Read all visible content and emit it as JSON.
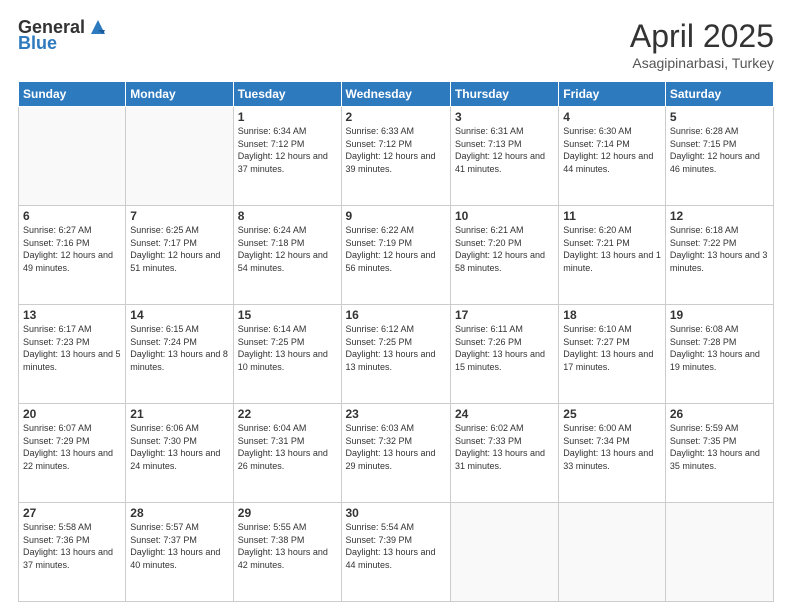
{
  "header": {
    "logo_general": "General",
    "logo_blue": "Blue",
    "title": "April 2025",
    "subtitle": "Asagipinarbasi, Turkey"
  },
  "calendar": {
    "days_of_week": [
      "Sunday",
      "Monday",
      "Tuesday",
      "Wednesday",
      "Thursday",
      "Friday",
      "Saturday"
    ],
    "weeks": [
      [
        {
          "day": "",
          "detail": ""
        },
        {
          "day": "",
          "detail": ""
        },
        {
          "day": "1",
          "detail": "Sunrise: 6:34 AM\nSunset: 7:12 PM\nDaylight: 12 hours and 37 minutes."
        },
        {
          "day": "2",
          "detail": "Sunrise: 6:33 AM\nSunset: 7:12 PM\nDaylight: 12 hours and 39 minutes."
        },
        {
          "day": "3",
          "detail": "Sunrise: 6:31 AM\nSunset: 7:13 PM\nDaylight: 12 hours and 41 minutes."
        },
        {
          "day": "4",
          "detail": "Sunrise: 6:30 AM\nSunset: 7:14 PM\nDaylight: 12 hours and 44 minutes."
        },
        {
          "day": "5",
          "detail": "Sunrise: 6:28 AM\nSunset: 7:15 PM\nDaylight: 12 hours and 46 minutes."
        }
      ],
      [
        {
          "day": "6",
          "detail": "Sunrise: 6:27 AM\nSunset: 7:16 PM\nDaylight: 12 hours and 49 minutes."
        },
        {
          "day": "7",
          "detail": "Sunrise: 6:25 AM\nSunset: 7:17 PM\nDaylight: 12 hours and 51 minutes."
        },
        {
          "day": "8",
          "detail": "Sunrise: 6:24 AM\nSunset: 7:18 PM\nDaylight: 12 hours and 54 minutes."
        },
        {
          "day": "9",
          "detail": "Sunrise: 6:22 AM\nSunset: 7:19 PM\nDaylight: 12 hours and 56 minutes."
        },
        {
          "day": "10",
          "detail": "Sunrise: 6:21 AM\nSunset: 7:20 PM\nDaylight: 12 hours and 58 minutes."
        },
        {
          "day": "11",
          "detail": "Sunrise: 6:20 AM\nSunset: 7:21 PM\nDaylight: 13 hours and 1 minute."
        },
        {
          "day": "12",
          "detail": "Sunrise: 6:18 AM\nSunset: 7:22 PM\nDaylight: 13 hours and 3 minutes."
        }
      ],
      [
        {
          "day": "13",
          "detail": "Sunrise: 6:17 AM\nSunset: 7:23 PM\nDaylight: 13 hours and 5 minutes."
        },
        {
          "day": "14",
          "detail": "Sunrise: 6:15 AM\nSunset: 7:24 PM\nDaylight: 13 hours and 8 minutes."
        },
        {
          "day": "15",
          "detail": "Sunrise: 6:14 AM\nSunset: 7:25 PM\nDaylight: 13 hours and 10 minutes."
        },
        {
          "day": "16",
          "detail": "Sunrise: 6:12 AM\nSunset: 7:25 PM\nDaylight: 13 hours and 13 minutes."
        },
        {
          "day": "17",
          "detail": "Sunrise: 6:11 AM\nSunset: 7:26 PM\nDaylight: 13 hours and 15 minutes."
        },
        {
          "day": "18",
          "detail": "Sunrise: 6:10 AM\nSunset: 7:27 PM\nDaylight: 13 hours and 17 minutes."
        },
        {
          "day": "19",
          "detail": "Sunrise: 6:08 AM\nSunset: 7:28 PM\nDaylight: 13 hours and 19 minutes."
        }
      ],
      [
        {
          "day": "20",
          "detail": "Sunrise: 6:07 AM\nSunset: 7:29 PM\nDaylight: 13 hours and 22 minutes."
        },
        {
          "day": "21",
          "detail": "Sunrise: 6:06 AM\nSunset: 7:30 PM\nDaylight: 13 hours and 24 minutes."
        },
        {
          "day": "22",
          "detail": "Sunrise: 6:04 AM\nSunset: 7:31 PM\nDaylight: 13 hours and 26 minutes."
        },
        {
          "day": "23",
          "detail": "Sunrise: 6:03 AM\nSunset: 7:32 PM\nDaylight: 13 hours and 29 minutes."
        },
        {
          "day": "24",
          "detail": "Sunrise: 6:02 AM\nSunset: 7:33 PM\nDaylight: 13 hours and 31 minutes."
        },
        {
          "day": "25",
          "detail": "Sunrise: 6:00 AM\nSunset: 7:34 PM\nDaylight: 13 hours and 33 minutes."
        },
        {
          "day": "26",
          "detail": "Sunrise: 5:59 AM\nSunset: 7:35 PM\nDaylight: 13 hours and 35 minutes."
        }
      ],
      [
        {
          "day": "27",
          "detail": "Sunrise: 5:58 AM\nSunset: 7:36 PM\nDaylight: 13 hours and 37 minutes."
        },
        {
          "day": "28",
          "detail": "Sunrise: 5:57 AM\nSunset: 7:37 PM\nDaylight: 13 hours and 40 minutes."
        },
        {
          "day": "29",
          "detail": "Sunrise: 5:55 AM\nSunset: 7:38 PM\nDaylight: 13 hours and 42 minutes."
        },
        {
          "day": "30",
          "detail": "Sunrise: 5:54 AM\nSunset: 7:39 PM\nDaylight: 13 hours and 44 minutes."
        },
        {
          "day": "",
          "detail": ""
        },
        {
          "day": "",
          "detail": ""
        },
        {
          "day": "",
          "detail": ""
        }
      ]
    ]
  }
}
